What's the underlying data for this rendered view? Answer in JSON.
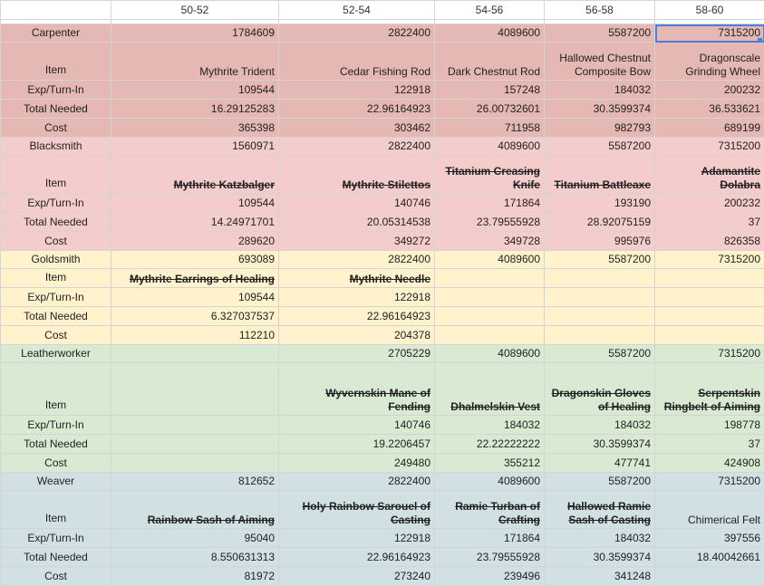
{
  "columns": [
    "",
    "50-52",
    "52-54",
    "54-56",
    "56-58",
    "58-60"
  ],
  "sections": [
    {
      "key": "carp",
      "name": "Carpenter",
      "totals": [
        "1784609",
        "2822400",
        "4089600",
        "5587200",
        "7315200"
      ],
      "item_label": "Item",
      "items": [
        "Mythrite Trident",
        "Cedar Fishing Rod",
        "Dark Chestnut Rod",
        "Hallowed Chestnut Composite Bow",
        "Dragonscale Grinding Wheel"
      ],
      "items_struck": [
        false,
        false,
        false,
        false,
        false
      ],
      "exp_label": "Exp/Turn-In",
      "exp": [
        "109544",
        "122918",
        "157248",
        "184032",
        "200232"
      ],
      "needed_label": "Total Needed",
      "needed": [
        "16.29125283",
        "22.96164923",
        "26.00732601",
        "30.3599374",
        "36.533621"
      ],
      "cost_label": "Cost",
      "cost": [
        "365398",
        "303462",
        "711958",
        "982793",
        "689199"
      ]
    },
    {
      "key": "black",
      "name": "Blacksmith",
      "totals": [
        "1560971",
        "2822400",
        "4089600",
        "5587200",
        "7315200"
      ],
      "item_label": "Item",
      "items": [
        "Mythrite Katzbalger",
        "Mythrite Stilettos",
        "Titanium Creasing Knife",
        "Titanium Battleaxe",
        "Adamantite Dolabra"
      ],
      "items_struck": [
        true,
        true,
        true,
        true,
        true
      ],
      "exp_label": "Exp/Turn-In",
      "exp": [
        "109544",
        "140746",
        "171864",
        "193190",
        "200232"
      ],
      "needed_label": "Total Needed",
      "needed": [
        "14.24971701",
        "20.05314538",
        "23.79555928",
        "28.92075159",
        "37"
      ],
      "cost_label": "Cost",
      "cost": [
        "289620",
        "349272",
        "349728",
        "995976",
        "826358"
      ]
    },
    {
      "key": "gold",
      "name": "Goldsmith",
      "totals": [
        "693089",
        "2822400",
        "4089600",
        "5587200",
        "7315200"
      ],
      "item_label": "Item",
      "items": [
        "Mythrite Earrings of Healing",
        "Mythrite Needle",
        "",
        "",
        ""
      ],
      "items_struck": [
        true,
        true,
        false,
        false,
        false
      ],
      "exp_label": "Exp/Turn-In",
      "exp": [
        "109544",
        "122918",
        "",
        "",
        ""
      ],
      "needed_label": "Total Needed",
      "needed": [
        "6.327037537",
        "22.96164923",
        "",
        "",
        ""
      ],
      "cost_label": "Cost",
      "cost": [
        "112210",
        "204378",
        "",
        "",
        ""
      ]
    },
    {
      "key": "leather",
      "name": "Leatherworker",
      "totals": [
        "",
        "2705229",
        "4089600",
        "5587200",
        "7315200"
      ],
      "item_label": "Item",
      "items": [
        "",
        "Wyvernskin Mane of Fending",
        "Dhalmelskin Vest",
        "Dragonskin Gloves of Healing",
        "Serpentskin Ringbelt of Aiming"
      ],
      "items_struck": [
        false,
        true,
        true,
        true,
        true
      ],
      "exp_label": "Exp/Turn-In",
      "exp": [
        "",
        "140746",
        "184032",
        "184032",
        "198778"
      ],
      "needed_label": "Total Needed",
      "needed": [
        "",
        "19.2206457",
        "22.22222222",
        "30.3599374",
        "37"
      ],
      "cost_label": "Cost",
      "cost": [
        "",
        "249480",
        "355212",
        "477741",
        "424908"
      ]
    },
    {
      "key": "weaver",
      "name": "Weaver",
      "totals": [
        "812652",
        "2822400",
        "4089600",
        "5587200",
        "7315200"
      ],
      "item_label": "Item",
      "items": [
        "Rainbow Sash of Aiming",
        "Holy Rainbow Sarouel of Casting",
        "Ramie Turban of Crafting",
        "Hallowed Ramie Sash of Casting",
        "Chimerical Felt"
      ],
      "items_struck": [
        true,
        true,
        true,
        true,
        false
      ],
      "exp_label": "Exp/Turn-In",
      "exp": [
        "95040",
        "122918",
        "171864",
        "184032",
        "397556"
      ],
      "needed_label": "Total Needed",
      "needed": [
        "8.550631313",
        "22.96164923",
        "23.79555928",
        "30.3599374",
        "18.40042661"
      ],
      "cost_label": "Cost",
      "cost": [
        "81972",
        "273240",
        "239496",
        "341248",
        ""
      ]
    }
  ],
  "colors": {
    "carpenter": "#e6b8b3",
    "blacksmith": "#f4cccc",
    "goldsmith": "#fff2cc",
    "leatherworker": "#d9ead3",
    "weaver": "#d0e0e3",
    "selection": "#4a7fe0"
  }
}
